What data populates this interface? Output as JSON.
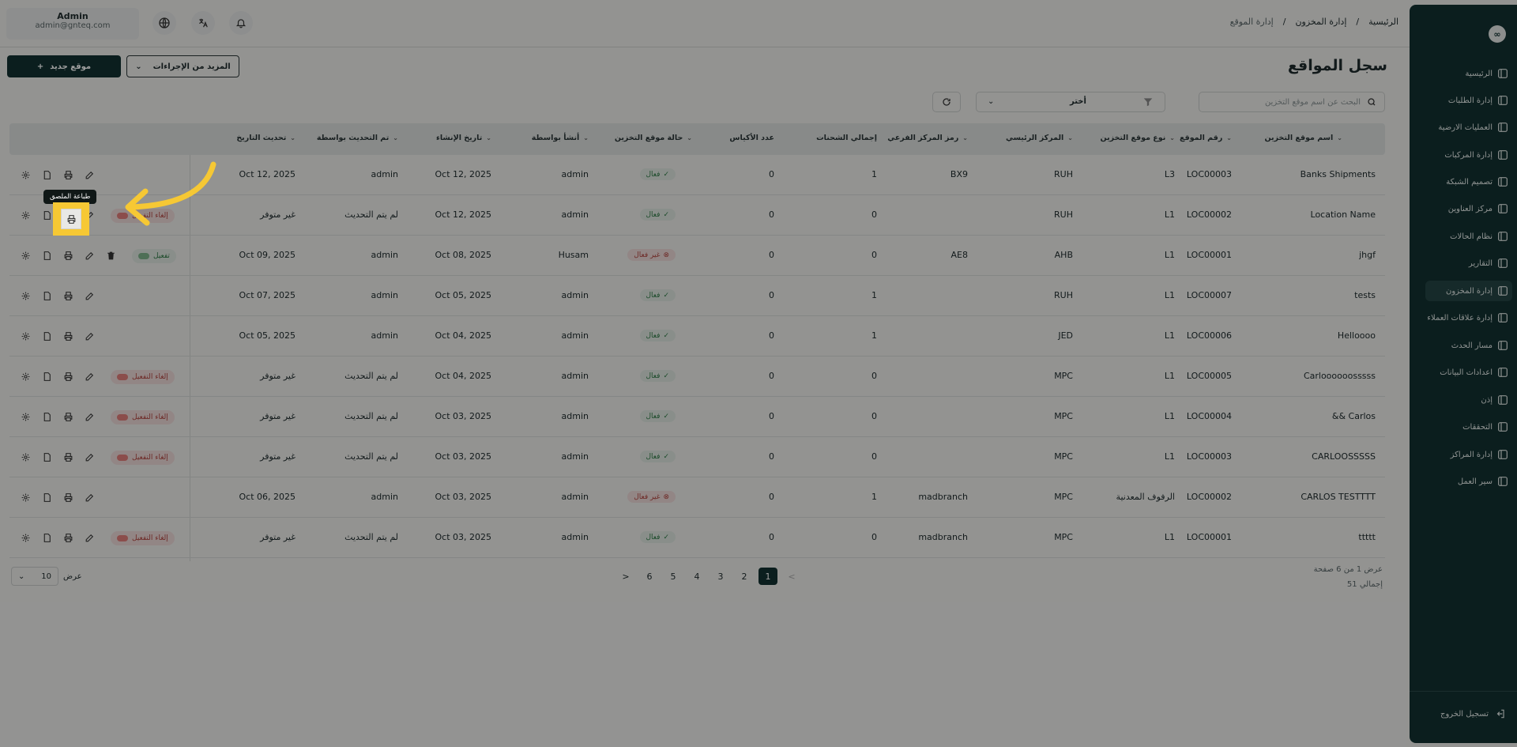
{
  "user": {
    "name": "Admin",
    "email": "admin@gnteq.com"
  },
  "breadcrumb": [
    "الرئيسية",
    "/",
    "إدارة المخزون",
    "/",
    "إدارة الموقع"
  ],
  "sidebar": {
    "items": [
      {
        "label": "الرئيسية",
        "icon": "dashboard-icon"
      },
      {
        "label": "إدارة الطلبات",
        "icon": "orders-icon"
      },
      {
        "label": "العمليات الارضية",
        "icon": "ground-ops-icon"
      },
      {
        "label": "إدارة المركبات",
        "icon": "truck-icon"
      },
      {
        "label": "تصميم الشبكة",
        "icon": "network-icon"
      },
      {
        "label": "مركز العناوين",
        "icon": "address-icon"
      },
      {
        "label": "نظام الحالات",
        "icon": "status-icon"
      },
      {
        "label": "التقارير",
        "icon": "reports-icon"
      },
      {
        "label": "إدارة المخزون",
        "icon": "inventory-icon"
      },
      {
        "label": "إدارة علاقات العملاء",
        "icon": "crm-icon"
      },
      {
        "label": "مسار الحدث",
        "icon": "route-icon"
      },
      {
        "label": "اعدادات البيانات",
        "icon": "database-icon"
      },
      {
        "label": "إذن",
        "icon": "users-icon"
      },
      {
        "label": "التحققات",
        "icon": "tools-icon"
      },
      {
        "label": "إدارة المراكز",
        "icon": "settings-icon"
      },
      {
        "label": "سير العمل",
        "icon": "workflow-icon"
      }
    ],
    "logout": "تسجيل الخروج"
  },
  "page": {
    "title": "سجل المواقع",
    "new_button": "موقع جديد",
    "more_button": "المزيد من الإجراءات",
    "search_placeholder": "البحث عن اسم موقع التخزين",
    "filter_label": "أختر"
  },
  "table": {
    "headers": [
      "اسم موقع التخزين",
      "رقم الموقع",
      "نوع موقع التخزين",
      "المركز الرئيسي",
      "رمز المركز الفرعي",
      "إجمالي الشحنات",
      "عدد الأكياس",
      "حالة موقع التخزين",
      "أنشأ بواسطة",
      "تاريخ الإنشاء",
      "تم التحديث بواسطة",
      "تحديث التاريخ"
    ],
    "rows": [
      {
        "name": "Banks Shipments",
        "loc": "LOC00003",
        "type": "L3",
        "hub": "RUH",
        "subhub": "BX9",
        "shipments": "1",
        "bags": "0",
        "status": "فعال",
        "created_by": "admin",
        "created": "Oct 12, 2025",
        "updated_by": "admin",
        "updated": "Oct 12, 2025",
        "toggle": ""
      },
      {
        "name": "Location Name",
        "loc": "LOC00002",
        "type": "L1",
        "hub": "RUH",
        "subhub": "",
        "shipments": "0",
        "bags": "0",
        "status": "فعال",
        "created_by": "admin",
        "created": "Oct 12, 2025",
        "updated_by": "لم يتم التحديث",
        "updated": "غير متوفر",
        "toggle": "إلغاء التفعيل"
      },
      {
        "name": "jhgf",
        "loc": "LOC00001",
        "type": "L1",
        "hub": "AHB",
        "subhub": "AE8",
        "shipments": "0",
        "bags": "0",
        "status": "غير فعال",
        "created_by": "Husam",
        "created": "Oct 08, 2025",
        "updated_by": "admin",
        "updated": "Oct 09, 2025",
        "toggle": "تفعيل"
      },
      {
        "name": "tests",
        "loc": "LOC00007",
        "type": "L1",
        "hub": "RUH",
        "subhub": "",
        "shipments": "1",
        "bags": "0",
        "status": "فعال",
        "created_by": "admin",
        "created": "Oct 05, 2025",
        "updated_by": "admin",
        "updated": "Oct 07, 2025",
        "toggle": ""
      },
      {
        "name": "Helloooo",
        "loc": "LOC00006",
        "type": "L1",
        "hub": "JED",
        "subhub": "",
        "shipments": "1",
        "bags": "0",
        "status": "فعال",
        "created_by": "admin",
        "created": "Oct 04, 2025",
        "updated_by": "admin",
        "updated": "Oct 05, 2025",
        "toggle": ""
      },
      {
        "name": "Carloooooosssss",
        "loc": "LOC00005",
        "type": "L1",
        "hub": "MPC",
        "subhub": "",
        "shipments": "0",
        "bags": "0",
        "status": "فعال",
        "created_by": "admin",
        "created": "Oct 04, 2025",
        "updated_by": "لم يتم التحديث",
        "updated": "غير متوفر",
        "toggle": "إلغاء التفعيل"
      },
      {
        "name": "&& Carlos",
        "loc": "LOC00004",
        "type": "L1",
        "hub": "MPC",
        "subhub": "",
        "shipments": "0",
        "bags": "0",
        "status": "فعال",
        "created_by": "admin",
        "created": "Oct 03, 2025",
        "updated_by": "لم يتم التحديث",
        "updated": "غير متوفر",
        "toggle": "إلغاء التفعيل"
      },
      {
        "name": "CARLOOSSSSS",
        "loc": "LOC00003",
        "type": "L1",
        "hub": "MPC",
        "subhub": "",
        "shipments": "0",
        "bags": "0",
        "status": "فعال",
        "created_by": "admin",
        "created": "Oct 03, 2025",
        "updated_by": "لم يتم التحديث",
        "updated": "غير متوفر",
        "toggle": "إلغاء التفعيل"
      },
      {
        "name": "CARLOS TESTTTT",
        "loc": "LOC00002",
        "type": "الرفوف المعدنية",
        "hub": "MPC",
        "subhub": "madbranch",
        "shipments": "1",
        "bags": "0",
        "status": "غير فعال",
        "created_by": "admin",
        "created": "Oct 03, 2025",
        "updated_by": "admin",
        "updated": "Oct 06, 2025",
        "toggle": ""
      },
      {
        "name": "ttttt",
        "loc": "LOC00001",
        "type": "L1",
        "hub": "MPC",
        "subhub": "madbranch",
        "shipments": "0",
        "bags": "0",
        "status": "فعال",
        "created_by": "admin",
        "created": "Oct 03, 2025",
        "updated_by": "لم يتم التحديث",
        "updated": "غير متوفر",
        "toggle": "إلغاء التفعيل"
      }
    ]
  },
  "pagination": {
    "pages": [
      "1",
      "2",
      "3",
      "4",
      "5",
      "6"
    ],
    "current": "1",
    "info_line1": "عرض 1 من 6 صفحة",
    "info_line2": "إجمالي 51",
    "per_page_label": "عرض",
    "per_page_value": "10",
    "next": ">",
    "prev": "<"
  },
  "tooltip": "طباعة الملصق",
  "colors": {
    "sidebar": "#123131",
    "accent": "#f6c834",
    "active": "#2f7a46",
    "inactive": "#b0433e"
  }
}
